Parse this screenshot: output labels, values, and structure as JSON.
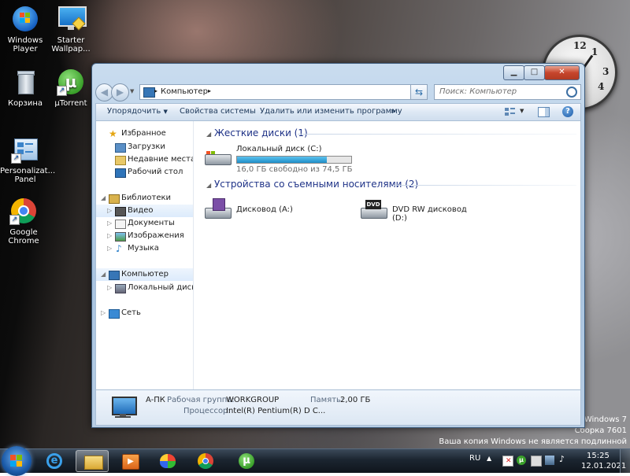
{
  "desktop": {
    "icons": [
      {
        "label": "Windows Player",
        "icon": "windows-player-icon"
      },
      {
        "label": "Starter Wallpap...",
        "icon": "starter-wallpaper-icon"
      },
      {
        "label": "Корзина",
        "icon": "recycle-bin-icon"
      },
      {
        "label": "µTorrent",
        "icon": "utorrent-icon"
      },
      {
        "label": "Personalizat... Panel",
        "icon": "personalization-panel-icon"
      },
      {
        "label": "Google Chrome",
        "icon": "chrome-icon"
      }
    ],
    "clock_numbers": [
      "12",
      "1",
      "3",
      "4"
    ],
    "watermark": {
      "line1": "Windows 7",
      "line2": "Сборка 7601",
      "line3": "Ваша копия Windows не является подлинной"
    }
  },
  "window": {
    "breadcrumb": "Компьютер",
    "search_placeholder": "Поиск: Компьютер",
    "toolbar": {
      "organize": "Упорядочить",
      "system_props": "Свойства системы",
      "uninstall": "Удалить или изменить программу",
      "more": "»"
    },
    "nav": {
      "favorites": "Избранное",
      "downloads": "Загрузки",
      "recent": "Недавние места",
      "desktop": "Рабочий стол",
      "libraries": "Библиотеки",
      "video": "Видео",
      "documents": "Документы",
      "images": "Изображения",
      "music": "Музыка",
      "computer": "Компьютер",
      "local_disk": "Локальный диск (C",
      "network": "Сеть"
    },
    "groups": {
      "hard_disks": "Жесткие диски (1)",
      "removable": "Устройства со съемными носителями (2)"
    },
    "drives": {
      "c_name": "Локальный диск (C:)",
      "c_free": "16,0 ГБ свободно из 74,5 ГБ",
      "c_used_fraction": 0.785,
      "floppy": "Дисковод (A:)",
      "dvd": "DVD RW дисковод (D:)",
      "dvd_badge": "DVD"
    },
    "details": {
      "pc_name": "A-ПК",
      "workgroup_label": "Рабочая группа:",
      "workgroup": "WORKGROUP",
      "memory_label": "Память:",
      "memory": "2,00 ГБ",
      "cpu_label": "Процессор:",
      "cpu": "Intel(R) Pentium(R) D C..."
    }
  },
  "taskbar": {
    "language": "RU",
    "time": "15:25",
    "date": "12.01.2021",
    "apps": [
      "explorer",
      "internet-explorer",
      "file-explorer",
      "media-player",
      "paint",
      "chrome",
      "utorrent"
    ]
  },
  "colors": {
    "accent_blue": "#1e3287",
    "progress": "#1f8ec8"
  }
}
